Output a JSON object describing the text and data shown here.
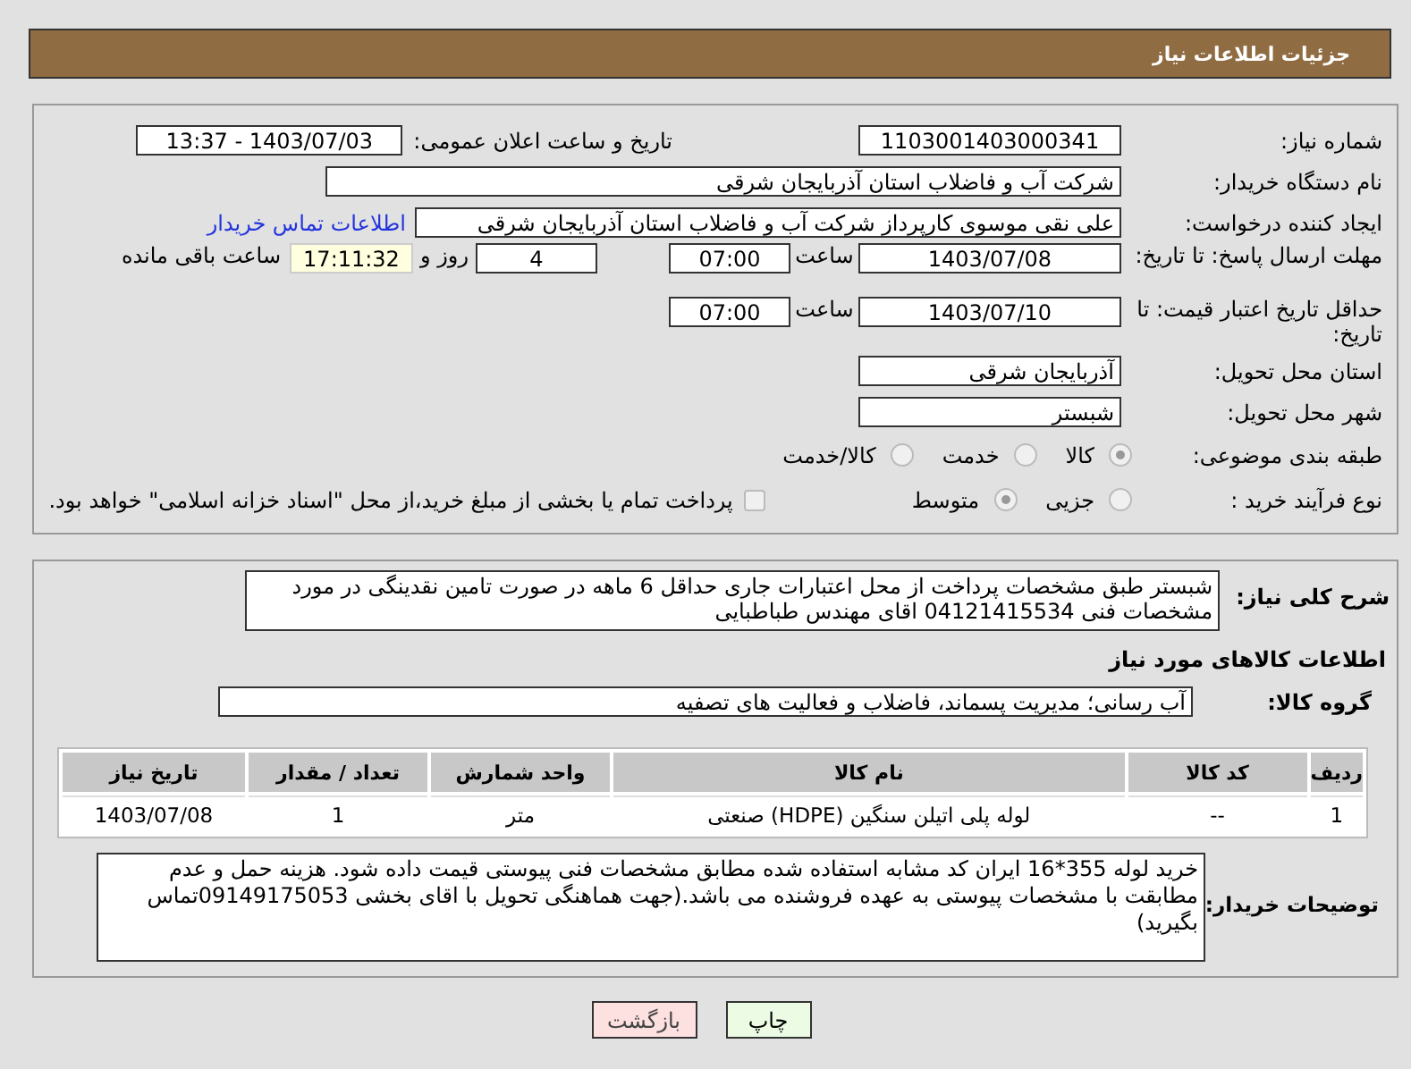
{
  "header": {
    "title": "جزئیات اطلاعات نیاز"
  },
  "need_number": {
    "label": "شماره نیاز:",
    "value": "1103001403000341"
  },
  "announce": {
    "label": "تاریخ و ساعت اعلان عمومی:",
    "value": "1403/07/03 - 13:37"
  },
  "buyer_org": {
    "label": "نام دستگاه خریدار:",
    "value": "شرکت آب و فاضلاب استان آذربایجان شرقی"
  },
  "requester": {
    "label": "ایجاد کننده درخواست:",
    "value": "علی نقی موسوی کارپرداز شرکت آب و فاضلاب استان آذربایجان شرقی",
    "link": "اطلاعات تماس خریدار"
  },
  "response_deadline": {
    "label": "مهلت ارسال پاسخ: تا تاریخ:",
    "date": "1403/07/08",
    "time_label": "ساعت",
    "time": "07:00",
    "days": "4",
    "days_label": "روز و",
    "remaining": "17:11:32",
    "remaining_label": "ساعت باقی مانده"
  },
  "price_validity": {
    "label": "حداقل تاریخ اعتبار قیمت: تا تاریخ:",
    "date": "1403/07/10",
    "time_label": "ساعت",
    "time": "07:00"
  },
  "province": {
    "label": "استان محل تحویل:",
    "value": "آذربایجان شرقی"
  },
  "city": {
    "label": "شهر محل تحویل:",
    "value": "شبستر"
  },
  "category": {
    "label": "طبقه بندی موضوعی:",
    "options": [
      {
        "label": "کالا",
        "selected": true
      },
      {
        "label": "خدمت",
        "selected": false
      },
      {
        "label": "کالا/خدمت",
        "selected": false
      }
    ]
  },
  "purchase_type": {
    "label": "نوع فرآیند خرید :",
    "options": [
      {
        "label": "جزیی",
        "selected": false
      },
      {
        "label": "متوسط",
        "selected": true
      }
    ],
    "treasury": {
      "checked": false,
      "text": "پرداخت تمام یا بخشی از مبلغ خرید،از محل \"اسناد خزانه اسلامی\" خواهد بود."
    }
  },
  "description": {
    "label": "شرح کلی نیاز:",
    "value": "شبستر  طبق مشخصات پرداخت از محل اعتبارات جاری حداقل 6 ماهه در صورت تامین نقدینگی  در مورد مشخصات فنی 04121415534 اقای مهندس طباطبایی"
  },
  "goods_heading": "اطلاعات کالاهای مورد نیاز",
  "goods_group": {
    "label": "گروه کالا:",
    "value": "آب رسانی؛ مدیریت پسماند، فاضلاب و فعالیت های تصفیه"
  },
  "table": {
    "columns": [
      "ردیف",
      "کد کالا",
      "نام کالا",
      "واحد شمارش",
      "تعداد / مقدار",
      "تاریخ نیاز"
    ],
    "rows": [
      [
        "1",
        "--",
        "لوله پلی اتیلن سنگین (HDPE) صنعتی",
        "متر",
        "1",
        "1403/07/08"
      ]
    ]
  },
  "buyer_notes": {
    "label": "توضیحات خریدار:",
    "value": "خرید   لوله 355*16 ایران کد مشابه استفاده شده مطابق مشخصات فنی پیوستی قیمت داده شود. هزینه حمل و عدم مطابقت با مشخصات پیوستی به عهده فروشنده می باشد.(جهت هماهنگی تحویل با اقای بخشی 09149175053تماس بگیرید)"
  },
  "buttons": [
    {
      "label": "چاپ",
      "kind": "print"
    },
    {
      "label": "بازگشت",
      "kind": "back"
    }
  ]
}
